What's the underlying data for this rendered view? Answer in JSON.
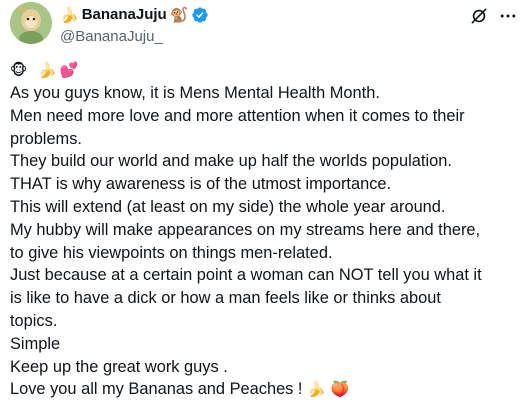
{
  "author": {
    "display_name": "BananaJuju",
    "name_prefix_emoji": "🍌",
    "name_suffix_emoji": "🐒",
    "handle": "@BananaJuju_",
    "verified": true,
    "verified_color": "#1d9bf0"
  },
  "actions": {
    "grok_icon": "grok-icon",
    "more_icon": "more-dots-icon"
  },
  "post": {
    "emoji_line": "🐵 🍌💕",
    "lines": [
      "As you guys know, it is Mens Mental Health Month.",
      "Men need more love and more attention when it comes to their",
      "problems.",
      "They build our world and make up half the worlds population.",
      "THAT is why awareness is of the utmost importance.",
      "This will extend (at least on my side) the whole year around.",
      "My hubby will make appearances on my streams here and there,",
      "to give his viewpoints on things men-related.",
      "Just because at a certain point a woman can NOT tell you what it",
      "is like to have a dick or how a man feels like or thinks about",
      "topics.",
      "Simple",
      "Keep up the great work guys .",
      "Love you all my Bananas and Peaches !"
    ],
    "last_line_emojis": "🍌 🍑"
  },
  "colors": {
    "text": "#0f1419",
    "secondary": "#536471",
    "accent": "#1d9bf0"
  }
}
